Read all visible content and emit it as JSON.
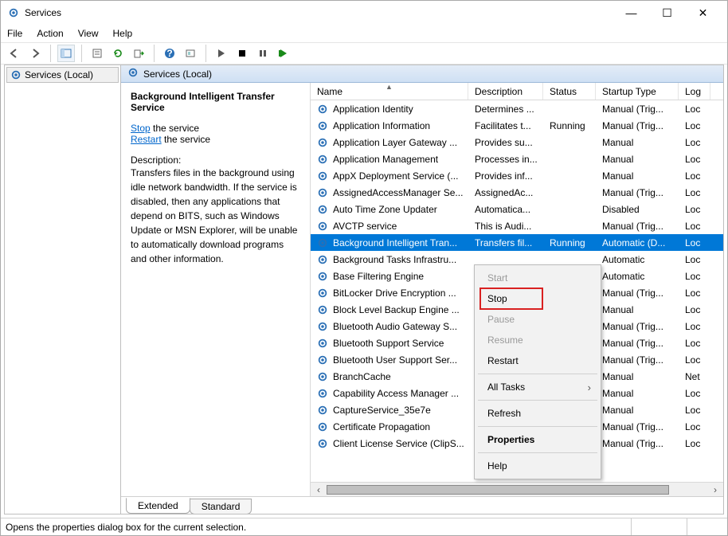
{
  "window": {
    "title": "Services"
  },
  "menubar": [
    "File",
    "Action",
    "View",
    "Help"
  ],
  "nav": {
    "root": "Services (Local)"
  },
  "content_header": "Services (Local)",
  "detail": {
    "service_name": "Background Intelligent Transfer Service",
    "stop_link": "Stop",
    "stop_tail": " the service",
    "restart_link": "Restart",
    "restart_tail": " the service",
    "desc_label": "Description:",
    "desc_text": "Transfers files in the background using idle network bandwidth. If the service is disabled, then any applications that depend on BITS, such as Windows Update or MSN Explorer, will be unable to automatically download programs and other information."
  },
  "columns": {
    "name": "Name",
    "desc": "Description",
    "status": "Status",
    "startup": "Startup Type",
    "log": "Log"
  },
  "services": [
    {
      "name": "Application Identity",
      "desc": "Determines ...",
      "status": "",
      "startup": "Manual (Trig...",
      "log": "Loc"
    },
    {
      "name": "Application Information",
      "desc": "Facilitates t...",
      "status": "Running",
      "startup": "Manual (Trig...",
      "log": "Loc"
    },
    {
      "name": "Application Layer Gateway ...",
      "desc": "Provides su...",
      "status": "",
      "startup": "Manual",
      "log": "Loc"
    },
    {
      "name": "Application Management",
      "desc": "Processes in...",
      "status": "",
      "startup": "Manual",
      "log": "Loc"
    },
    {
      "name": "AppX Deployment Service (...",
      "desc": "Provides inf...",
      "status": "",
      "startup": "Manual",
      "log": "Loc"
    },
    {
      "name": "AssignedAccessManager Se...",
      "desc": "AssignedAc...",
      "status": "",
      "startup": "Manual (Trig...",
      "log": "Loc"
    },
    {
      "name": "Auto Time Zone Updater",
      "desc": "Automatica...",
      "status": "",
      "startup": "Disabled",
      "log": "Loc"
    },
    {
      "name": "AVCTP service",
      "desc": "This is Audi...",
      "status": "",
      "startup": "Manual (Trig...",
      "log": "Loc"
    },
    {
      "name": "Background Intelligent Tran...",
      "desc": "Transfers fil...",
      "status": "Running",
      "startup": "Automatic (D...",
      "log": "Loc",
      "selected": true
    },
    {
      "name": "Background Tasks Infrastru...",
      "desc": "",
      "status": "",
      "startup": "Automatic",
      "log": "Loc"
    },
    {
      "name": "Base Filtering Engine",
      "desc": "",
      "status": "",
      "startup": "Automatic",
      "log": "Loc"
    },
    {
      "name": "BitLocker Drive Encryption ...",
      "desc": "",
      "status": "",
      "startup": "Manual (Trig...",
      "log": "Loc"
    },
    {
      "name": "Block Level Backup Engine ...",
      "desc": "",
      "status": "",
      "startup": "Manual",
      "log": "Loc"
    },
    {
      "name": "Bluetooth Audio Gateway S...",
      "desc": "",
      "status": "",
      "startup": "Manual (Trig...",
      "log": "Loc"
    },
    {
      "name": "Bluetooth Support Service",
      "desc": "",
      "status": "",
      "startup": "Manual (Trig...",
      "log": "Loc"
    },
    {
      "name": "Bluetooth User Support Ser...",
      "desc": "",
      "status": "",
      "startup": "Manual (Trig...",
      "log": "Loc"
    },
    {
      "name": "BranchCache",
      "desc": "",
      "status": "",
      "startup": "Manual",
      "log": "Net"
    },
    {
      "name": "Capability Access Manager ...",
      "desc": "",
      "status": "",
      "startup": "Manual",
      "log": "Loc"
    },
    {
      "name": "CaptureService_35e7e",
      "desc": "",
      "status": "",
      "startup": "Manual",
      "log": "Loc"
    },
    {
      "name": "Certificate Propagation",
      "desc": "",
      "status": "",
      "startup": "Manual (Trig...",
      "log": "Loc"
    },
    {
      "name": "Client License Service (ClipS...",
      "desc": "",
      "status": "",
      "startup": "Manual (Trig...",
      "log": "Loc"
    }
  ],
  "tabs": {
    "extended": "Extended",
    "standard": "Standard"
  },
  "context_menu": {
    "start": "Start",
    "stop": "Stop",
    "pause": "Pause",
    "resume": "Resume",
    "restart": "Restart",
    "all_tasks": "All Tasks",
    "refresh": "Refresh",
    "properties": "Properties",
    "help": "Help"
  },
  "statusbar": "Opens the properties dialog box for the current selection."
}
